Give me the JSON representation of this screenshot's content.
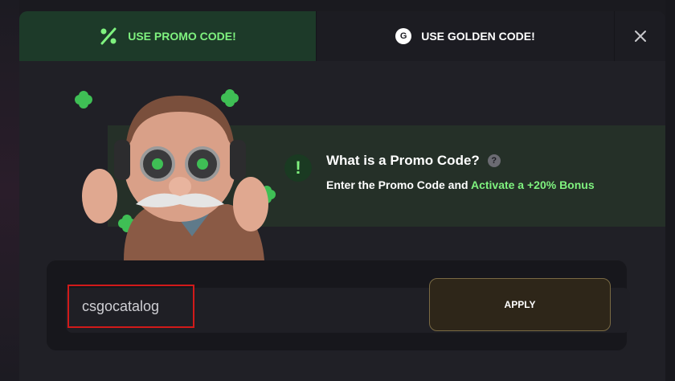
{
  "tabs": {
    "promo_label": "USE PROMO CODE!",
    "golden_label": "USE GOLDEN CODE!",
    "golden_badge": "G"
  },
  "info": {
    "title": "What is a Promo Code?",
    "help_glyph": "?",
    "exclaim_glyph": "!",
    "desc_prefix": "Enter the Promo Code and ",
    "desc_accent": "Activate a +20% Bonus"
  },
  "form": {
    "input_value": "csgocatalog",
    "apply_label": "APPLY"
  },
  "colors": {
    "accent_green": "#7ff27f",
    "active_tab_bg": "#1d3a29",
    "highlight_red": "#d11a1a",
    "apply_border": "#7a6a44"
  },
  "icons": {
    "promo_tab": "percent-icon",
    "golden_tab": "g-coin-icon",
    "close": "close-icon",
    "info": "exclamation-icon",
    "help": "question-icon"
  }
}
